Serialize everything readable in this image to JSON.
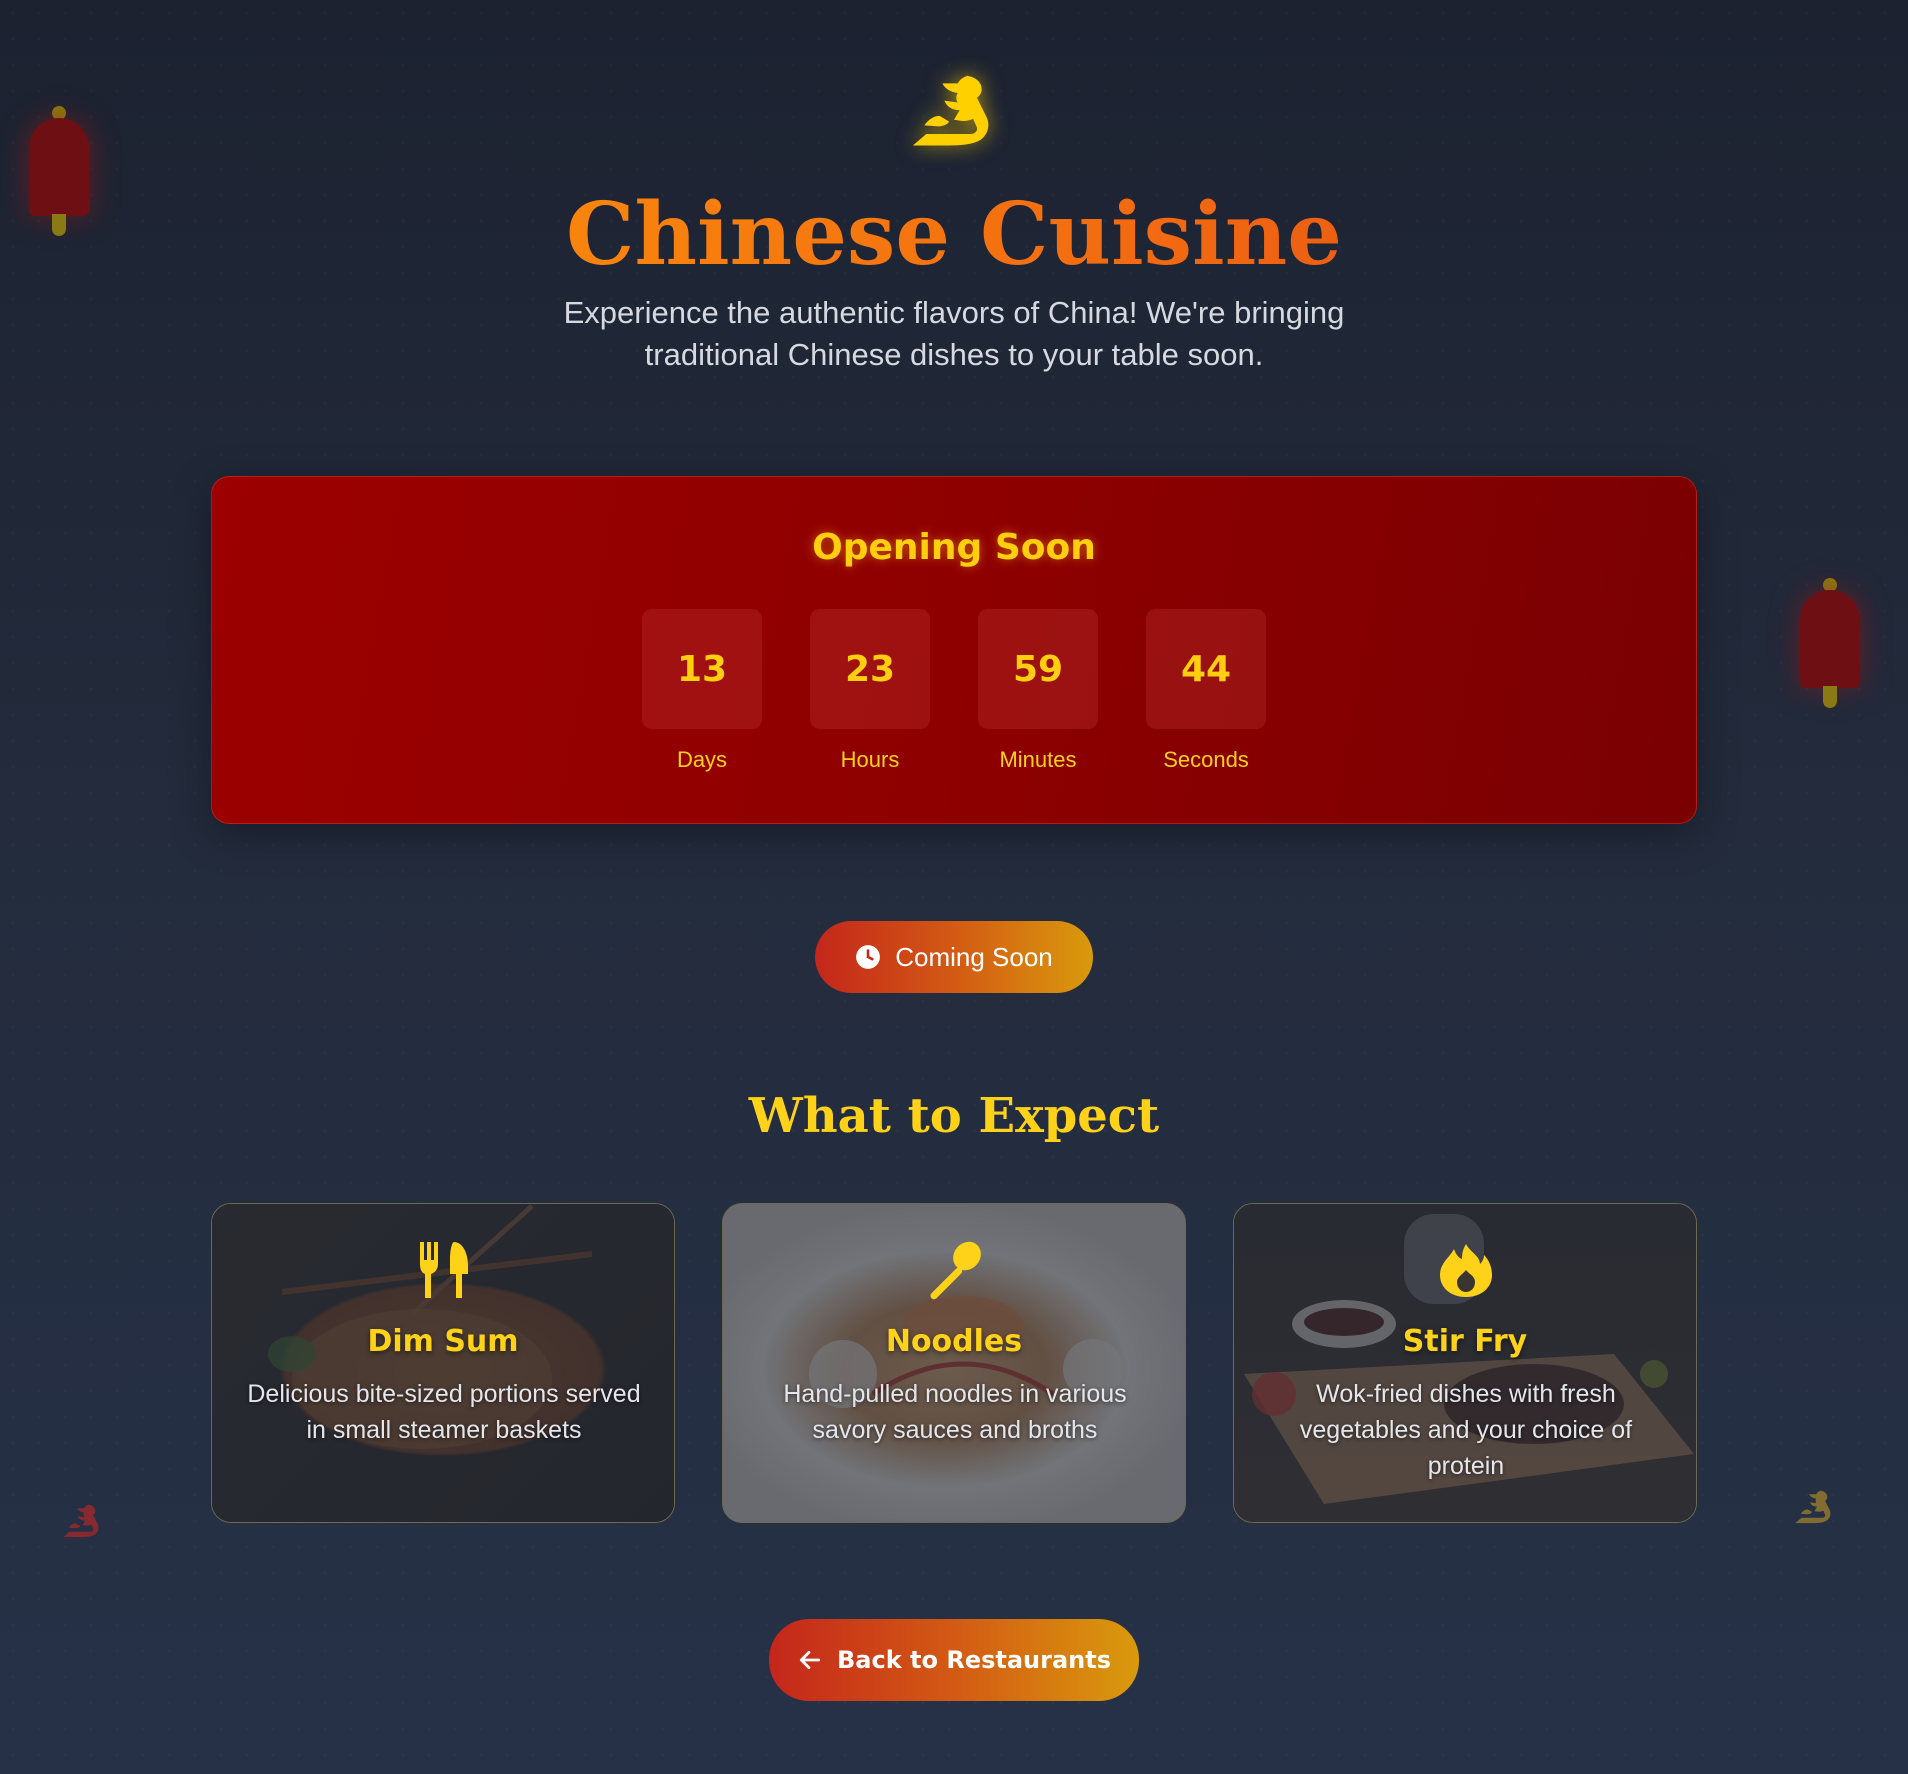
{
  "header": {
    "logo_icon": "dragon-icon",
    "title": "Chinese Cuisine",
    "subtitle": "Experience the authentic flavors of China! We're bringing traditional Chinese dishes to your table soon."
  },
  "countdown": {
    "title": "Opening Soon",
    "units": [
      {
        "value": "13",
        "label": "Days"
      },
      {
        "value": "23",
        "label": "Hours"
      },
      {
        "value": "59",
        "label": "Minutes"
      },
      {
        "value": "44",
        "label": "Seconds"
      }
    ]
  },
  "status_button": {
    "icon": "clock-icon",
    "label": "Coming Soon"
  },
  "expect": {
    "title": "What to Expect",
    "cards": [
      {
        "icon": "utensils-icon",
        "name": "Dim Sum",
        "description": "Delicious bite-sized portions served in small steamer baskets"
      },
      {
        "icon": "spoon-icon",
        "name": "Noodles",
        "description": "Hand-pulled noodles in various savory sauces and broths"
      },
      {
        "icon": "fire-icon",
        "name": "Stir Fry",
        "description": "Wok-fried dishes with fresh vegetables and your choice of protein"
      }
    ]
  },
  "back_button": {
    "icon": "arrow-left-icon",
    "label": "Back to Restaurants"
  },
  "colors": {
    "accent_gold": "#ffd21a",
    "title_orange": "#f7820f",
    "countdown_red": "#8e0000",
    "background": "#232b3c"
  }
}
